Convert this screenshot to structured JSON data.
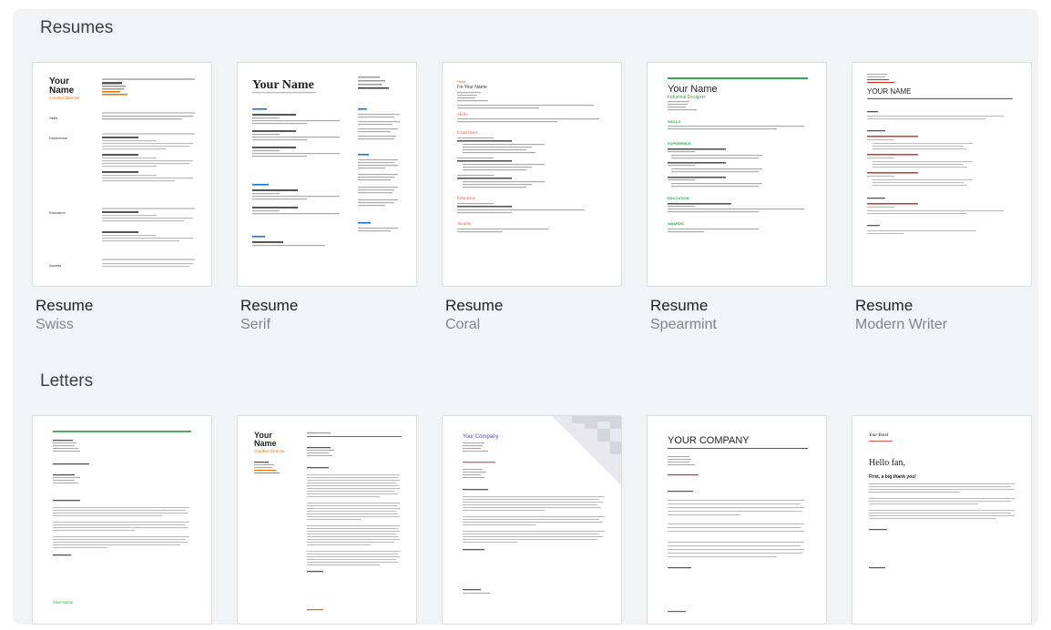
{
  "sections": [
    {
      "title": "Resumes",
      "templates": [
        {
          "name": "Resume",
          "style": "Swiss"
        },
        {
          "name": "Resume",
          "style": "Serif"
        },
        {
          "name": "Resume",
          "style": "Coral"
        },
        {
          "name": "Resume",
          "style": "Spearmint"
        },
        {
          "name": "Resume",
          "style": "Modern Writer"
        }
      ]
    },
    {
      "title": "Letters"
    }
  ],
  "previews": {
    "swiss": {
      "name": "Your\nName",
      "role": "Creative Director",
      "labels": [
        "Skills",
        "Experience",
        "Education",
        "Awards"
      ]
    },
    "serif": {
      "name": "Your Name"
    },
    "coral": {
      "heading": "Hello",
      "name": "I'm Your Name",
      "labels": [
        "Skills",
        "Experience",
        "Education",
        "Awards"
      ]
    },
    "spearmint": {
      "name": "Your Name",
      "role": "Industrial Designer",
      "labels": [
        "SKILLS",
        "EXPERIENCE",
        "EDUCATION",
        "AWARDS"
      ]
    },
    "modern": {
      "name": "YOUR NAME"
    },
    "letter_company": {
      "name": "Your Company"
    },
    "letter_swiss": {
      "name": "Your\nName",
      "role": "Creative Director"
    },
    "letter_big": {
      "name": "YOUR COMPANY"
    },
    "letter_fan": {
      "script": "Your Band",
      "greeting": "Hello fan,",
      "sub": "First, a big thank you!"
    },
    "letter_green": {
      "footer": "Your Name"
    }
  },
  "colors": {
    "panel": "#f1f3f4",
    "accent_orange": "#e8710a",
    "accent_green": "#34a853",
    "accent_blue": "#1a73e8",
    "accent_coral": "#e06055",
    "accent_purple": "#5b3fc4",
    "accent_red": "#d93025"
  }
}
